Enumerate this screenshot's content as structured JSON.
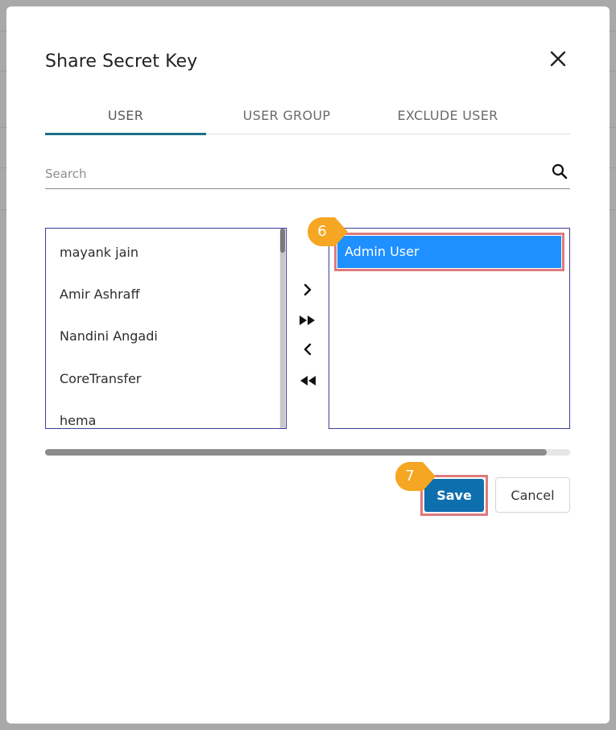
{
  "dialog": {
    "title": "Share Secret Key"
  },
  "tabs": [
    {
      "label": "USER",
      "active": true
    },
    {
      "label": "USER GROUP",
      "active": false
    },
    {
      "label": "EXCLUDE USER",
      "active": false
    }
  ],
  "search": {
    "placeholder": "Search",
    "value": ""
  },
  "available_users": [
    "mayank jain",
    "Amir Ashraff",
    "Nandini Angadi",
    "CoreTransfer",
    "hema"
  ],
  "selected_users": [
    "Admin User"
  ],
  "buttons": {
    "save": "Save",
    "cancel": "Cancel"
  },
  "annotations": {
    "step_selected": "6",
    "step_save": "7"
  },
  "colors": {
    "accent_tab": "#1f6f86",
    "selected_item": "#1e90ff",
    "save_button": "#0e6fae",
    "callout": "#f5a623",
    "highlight_border": "#e07a7d"
  },
  "icons": {
    "close": "close-icon",
    "search": "search-icon",
    "move_right": "chevron-right-icon",
    "move_all_right": "double-triangle-right-icon",
    "move_left": "chevron-left-icon",
    "move_all_left": "double-triangle-left-icon"
  }
}
